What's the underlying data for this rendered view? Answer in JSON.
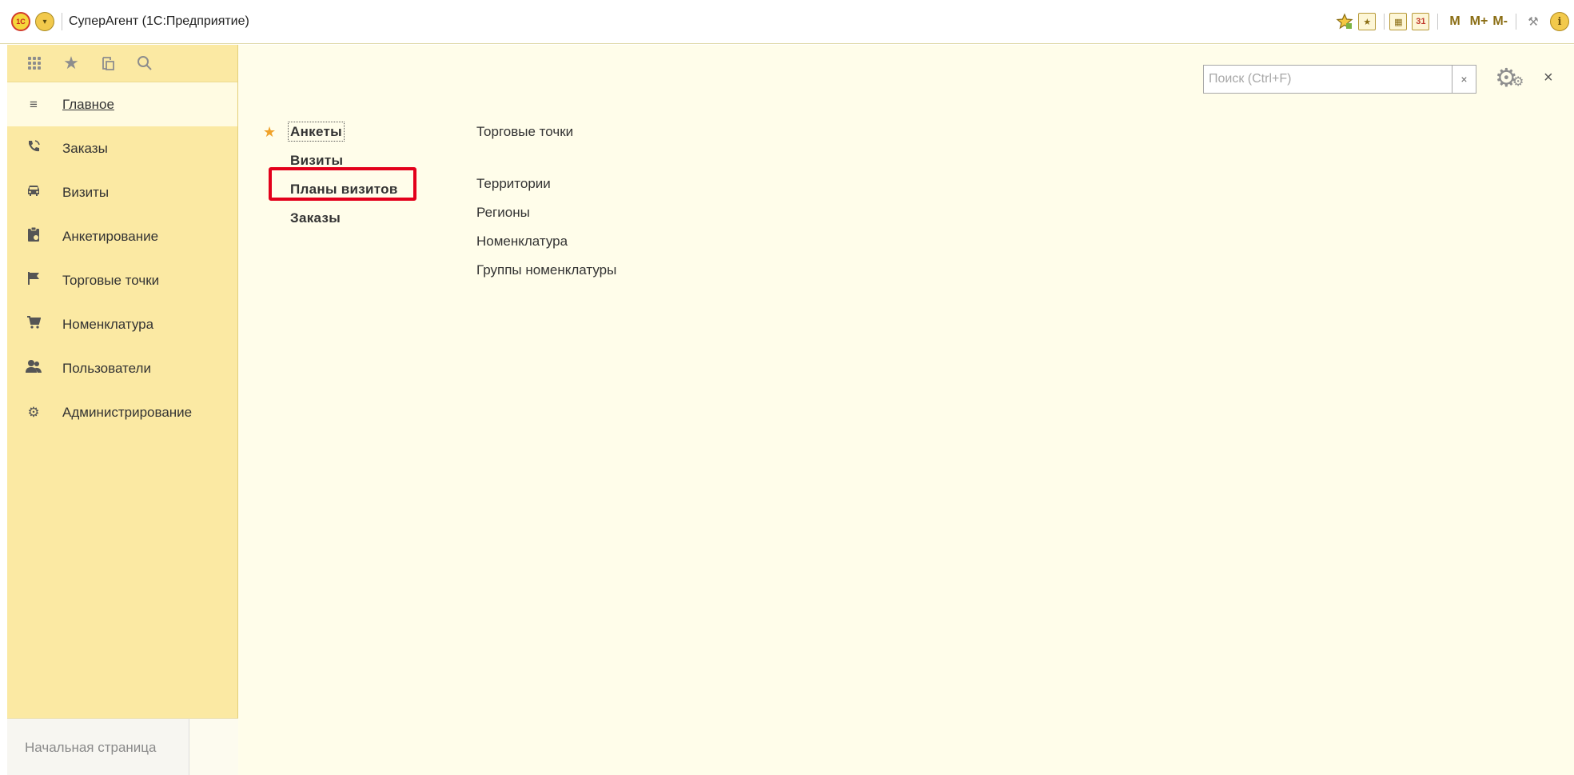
{
  "titlebar": {
    "logo_text": "1C",
    "app_title": "СуперАгент  (1С:Предприятие)",
    "icons": [
      "favorites-icon",
      "history-icon",
      "calculator-icon",
      "calendar-icon",
      "tools-icon",
      "info-icon"
    ],
    "memory_buttons": [
      "M",
      "M+",
      "M-"
    ]
  },
  "sidebar": {
    "tools": [
      "all-functions-icon",
      "favorites-icon",
      "history-icon",
      "search-icon"
    ],
    "items": [
      {
        "label": "Главное",
        "icon": "hamburger-icon",
        "active": true
      },
      {
        "label": "Заказы",
        "icon": "phone-icon"
      },
      {
        "label": "Визиты",
        "icon": "car-icon"
      },
      {
        "label": "Анкетирование",
        "icon": "clipboard-icon"
      },
      {
        "label": "Торговые точки",
        "icon": "flag-icon"
      },
      {
        "label": "Номенклатура",
        "icon": "cart-icon"
      },
      {
        "label": "Пользователи",
        "icon": "users-icon"
      },
      {
        "label": "Администрирование",
        "icon": "gear-icon"
      }
    ],
    "home_tab": "Начальная страница"
  },
  "main": {
    "search": {
      "placeholder": "Поиск (Ctrl+F)",
      "value": ""
    },
    "left_links": [
      "Анкеты",
      "Визиты",
      "Планы визитов",
      "Заказы"
    ],
    "right_links_group1": [
      "Торговые точки"
    ],
    "right_links_group2": [
      "Территории",
      "Регионы",
      "Номенклатура",
      "Группы номенклатуры"
    ]
  },
  "colors": {
    "sidebar_bg": "#fbe9a3",
    "content_bg": "#fffdea",
    "highlight_border": "#e3001b",
    "star": "#f0a22a"
  }
}
